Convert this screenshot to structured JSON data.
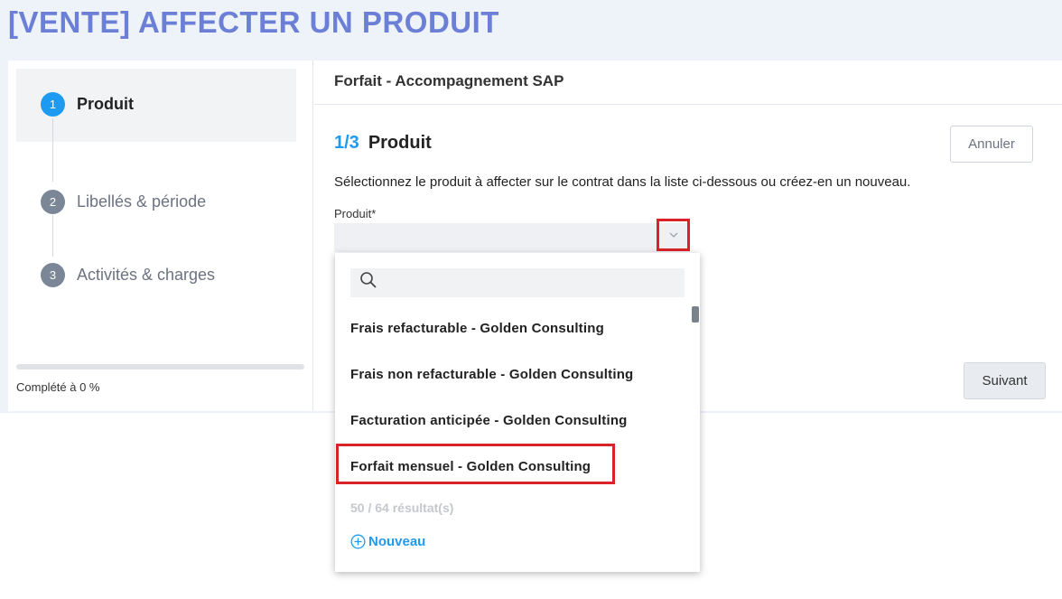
{
  "page": {
    "title": "[VENTE] AFFECTER UN PRODUIT"
  },
  "stepper": {
    "steps": [
      {
        "number": "1",
        "label": "Produit",
        "state": "active"
      },
      {
        "number": "2",
        "label": "Libellés & période",
        "state": "inactive"
      },
      {
        "number": "3",
        "label": "Activités & charges",
        "state": "inactive"
      }
    ],
    "progress": {
      "percent": 0,
      "label": "Complété à 0 %"
    }
  },
  "main": {
    "header_title": "Forfait - Accompagnement SAP",
    "step_fraction": "1/3",
    "step_name": "Produit",
    "cancel_label": "Annuler",
    "instruction": "Sélectionnez le produit à affecter sur le contrat dans la liste ci-dessous ou créez-en un nouveau.",
    "field_label": "Produit*",
    "next_label": "Suivant"
  },
  "dropdown": {
    "search_value": "",
    "options": [
      "Frais refacturable - Golden Consulting",
      "Frais non refacturable - Golden Consulting",
      "Facturation anticipée - Golden Consulting",
      "Forfait mensuel - Golden Consulting"
    ],
    "result_count": "50 / 64 résultat(s)",
    "new_label": "Nouveau"
  },
  "icons": {
    "search": "search-icon",
    "chevron": "chevron-down-icon",
    "add": "plus-circle-icon"
  },
  "colors": {
    "accent": "#1e9bf0",
    "title": "#6b7fd6",
    "highlight": "#d9232a"
  }
}
